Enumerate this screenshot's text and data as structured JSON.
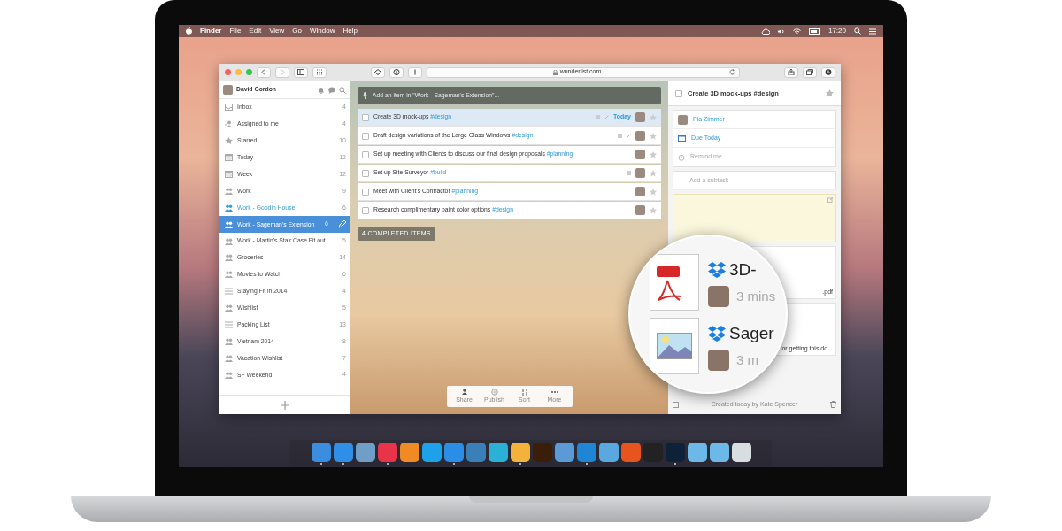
{
  "menu_bar": {
    "items": [
      "Finder",
      "File",
      "Edit",
      "View",
      "Go",
      "Window",
      "Help"
    ],
    "clock": "17:20"
  },
  "browser": {
    "url": "wunderlist.com"
  },
  "sidebar": {
    "user": "David Gordon",
    "items": [
      {
        "kind": "inbox",
        "label": "Inbox",
        "count": "4",
        "selected": false,
        "shared_active": false
      },
      {
        "kind": "assigned",
        "label": "Assigned to me",
        "count": "4",
        "selected": false,
        "shared_active": false
      },
      {
        "kind": "star",
        "label": "Starred",
        "count": "10",
        "selected": false,
        "shared_active": false
      },
      {
        "kind": "calendar",
        "label": "Today",
        "count": "12",
        "selected": false,
        "shared_active": false
      },
      {
        "kind": "calendar",
        "label": "Week",
        "count": "12",
        "selected": false,
        "shared_active": false
      },
      {
        "kind": "people",
        "label": "Work",
        "count": "9",
        "selected": false,
        "shared_active": false
      },
      {
        "kind": "people",
        "label": "Work - Goodin House",
        "count": "6",
        "selected": false,
        "shared_active": true
      },
      {
        "kind": "people",
        "label": "Work - Sageman's Extension",
        "count": "6",
        "selected": true,
        "shared_active": false
      },
      {
        "kind": "people",
        "label": "Work - Martin's Stair Case Fit out",
        "count": "5",
        "selected": false,
        "shared_active": false
      },
      {
        "kind": "people",
        "label": "Groceries",
        "count": "14",
        "selected": false,
        "shared_active": false
      },
      {
        "kind": "people",
        "label": "Movies to Watch",
        "count": "6",
        "selected": false,
        "shared_active": false
      },
      {
        "kind": "list",
        "label": "Staying Fit in 2014",
        "count": "4",
        "selected": false,
        "shared_active": false
      },
      {
        "kind": "people",
        "label": "Wishlist",
        "count": "5",
        "selected": false,
        "shared_active": false
      },
      {
        "kind": "list",
        "label": "Packing List",
        "count": "13",
        "selected": false,
        "shared_active": false
      },
      {
        "kind": "people",
        "label": "Vietnam 2014",
        "count": "8",
        "selected": false,
        "shared_active": false
      },
      {
        "kind": "people",
        "label": "Vacation Wishlist",
        "count": "7",
        "selected": false,
        "shared_active": false
      },
      {
        "kind": "people",
        "label": "SF Weekend",
        "count": "4",
        "selected": false,
        "shared_active": false
      }
    ]
  },
  "add_item": {
    "placeholder": "Add an item in \"Work - Sageman's Extension\"..."
  },
  "tasks": [
    {
      "title": "Create 3D mock-ups",
      "tag": "#design",
      "selected": true,
      "note": true,
      "attachment": true,
      "due": "Today"
    },
    {
      "title": "Draft design variations of the Large Glass Windows",
      "tag": "#design",
      "selected": false,
      "note": true,
      "attachment": true
    },
    {
      "title": "Set up meeting with Clients to discuss our final design proposals",
      "tag": "#planning",
      "selected": false,
      "note": false,
      "attachment": false
    },
    {
      "title": "Set up Site Surveyor",
      "tag": "#build",
      "selected": false,
      "note": true,
      "attachment": false
    },
    {
      "title": "Meet with Client's Contractor",
      "tag": "#planning",
      "selected": false,
      "note": false,
      "attachment": false
    },
    {
      "title": "Research complimentary paint color options",
      "tag": "#design",
      "selected": false,
      "note": false,
      "attachment": false
    }
  ],
  "completed_button": "4 COMPLETED ITEMS",
  "list_toolbar": [
    "Share",
    "Publish",
    "Sort",
    "More"
  ],
  "detail": {
    "checked": false,
    "title": "Create 3D mock-ups #design",
    "assignee": "Pia Zimmer",
    "due": "Due Today",
    "reminder": "Remind me",
    "subtask_placeholder": "Add a subtask",
    "file_peeks": [
      ".pdf",
      "for getting this do..."
    ],
    "footer": "Created today by Kate Spencer"
  },
  "magnifier": {
    "files": [
      {
        "kind": "pdf",
        "name": "3D-",
        "time": "3 mins"
      },
      {
        "kind": "image",
        "name": "Sager",
        "time": "3 m"
      }
    ]
  },
  "dock": [
    {
      "color": "#3b8de0",
      "running": true
    },
    {
      "color": "#2f8fe8",
      "running": true
    },
    {
      "color": "#6f9fc8",
      "running": false
    },
    {
      "color": "#e8344a",
      "running": true
    },
    {
      "color": "#f08a24",
      "running": false
    },
    {
      "color": "#1da1e8",
      "running": false
    },
    {
      "color": "#2a8ee6",
      "running": true
    },
    {
      "color": "#3a7fb8",
      "running": false
    },
    {
      "color": "#2bb0d8",
      "running": false
    },
    {
      "color": "#f3b33b",
      "running": true
    },
    {
      "color": "#3a1e08",
      "running": false
    },
    {
      "color": "#5a9ad6",
      "running": false
    },
    {
      "color": "#1f86d6",
      "running": true
    },
    {
      "color": "#5aa8e0",
      "running": false
    },
    {
      "color": "#e8541e",
      "running": false
    },
    {
      "color": "#222222",
      "running": false
    },
    {
      "color": "#0d2238",
      "running": true
    },
    {
      "color": "#6cb8e8",
      "running": false
    },
    {
      "color": "#6cb8e8",
      "running": false
    },
    {
      "color": "#d8dde2",
      "running": false
    }
  ]
}
